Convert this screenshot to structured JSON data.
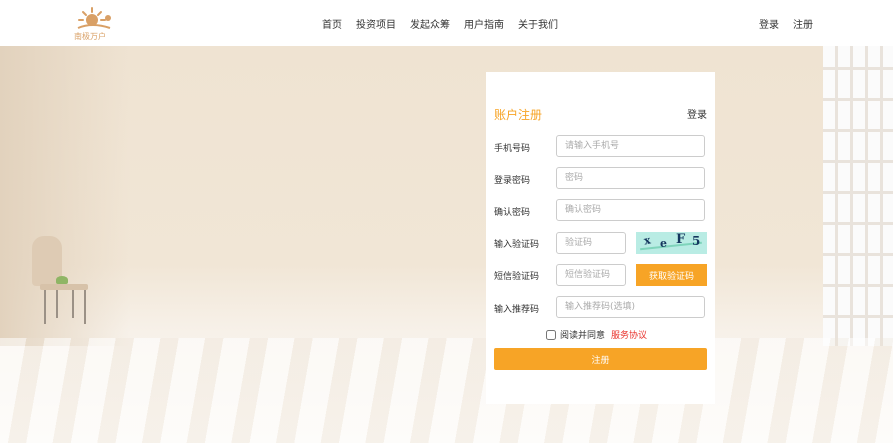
{
  "header": {
    "logo_text": "南极万户",
    "nav": [
      "首页",
      "投资项目",
      "发起众筹",
      "用户指南",
      "关于我们"
    ],
    "login": "登录",
    "register": "注册"
  },
  "form": {
    "title": "账户注册",
    "login_link": "登录",
    "phone": {
      "label": "手机号码",
      "placeholder": "请输入手机号",
      "value": ""
    },
    "password": {
      "label": "登录密码",
      "placeholder": "密码",
      "value": ""
    },
    "confirm": {
      "label": "确认密码",
      "placeholder": "确认密码",
      "value": ""
    },
    "captcha": {
      "label": "输入验证码",
      "placeholder": "验证码",
      "value": "",
      "image_text": [
        "x",
        "e",
        "F",
        "5"
      ]
    },
    "sms": {
      "label": "短信验证码",
      "placeholder": "短信验证码",
      "value": "",
      "button": "获取验证码"
    },
    "referral": {
      "label": "输入推荐码",
      "placeholder": "输入推荐码(选填)",
      "value": ""
    },
    "agree_text": "阅读并同意",
    "agree_link": "服务协议",
    "agree_checked": false,
    "submit": "注册"
  },
  "colors": {
    "accent": "#f7a426",
    "link_red": "#e8322c",
    "captcha_bg": "#b9ece4"
  }
}
